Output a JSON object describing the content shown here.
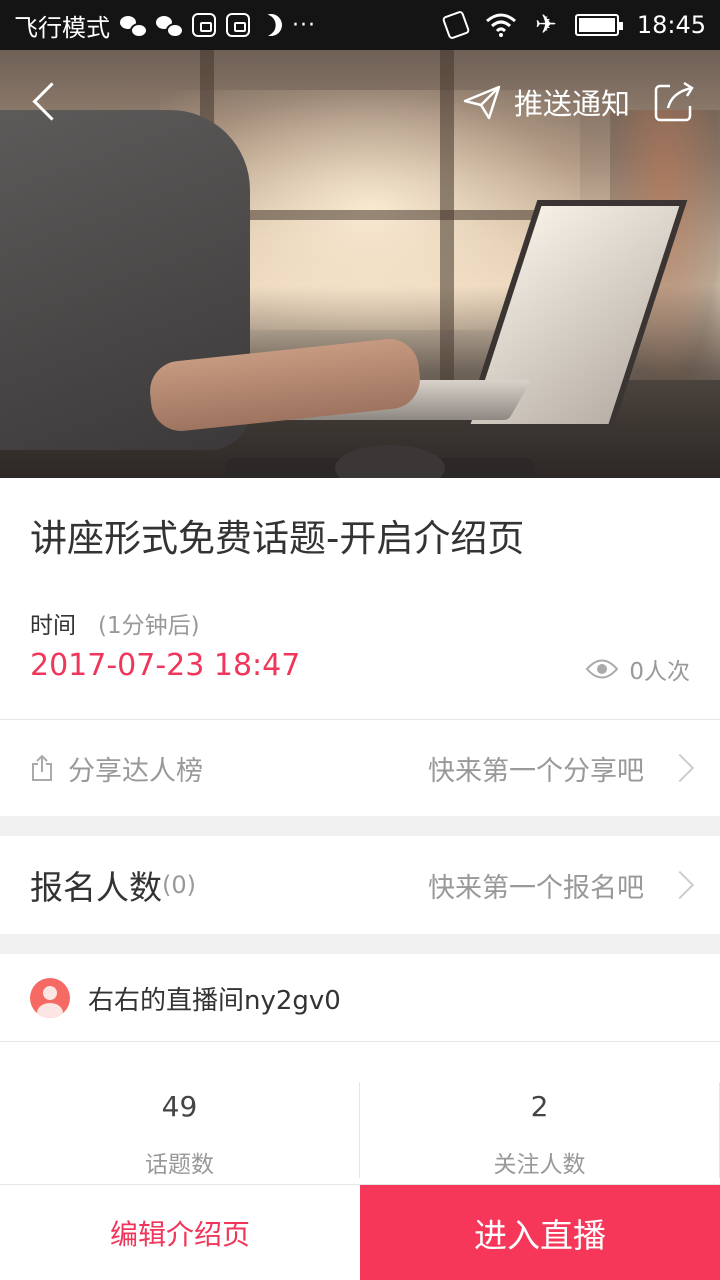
{
  "status_bar": {
    "left_text": "飞行模式",
    "dots": "···",
    "time": "18:45"
  },
  "header": {
    "push_label": "推送通知"
  },
  "topic": {
    "title": "讲座形式免费话题-开启介绍页",
    "time_label": "时间",
    "time_relative": "(1分钟后)",
    "datetime": "2017-07-23 18:47",
    "views": "0人次"
  },
  "share_rank": {
    "label": "分享达人榜",
    "hint": "快来第一个分享吧"
  },
  "signup": {
    "label": "报名人数",
    "count": "(0)",
    "hint": "快来第一个报名吧"
  },
  "host": {
    "name": "右右的直播间ny2gv0"
  },
  "stats": [
    {
      "value": "49",
      "label": "话题数"
    },
    {
      "value": "2",
      "label": "关注人数"
    }
  ],
  "actions": {
    "edit_label": "编辑介绍页",
    "enter_label": "进入直播"
  },
  "colors": {
    "accent": "#f0365a",
    "primary_button": "#f7375a"
  }
}
